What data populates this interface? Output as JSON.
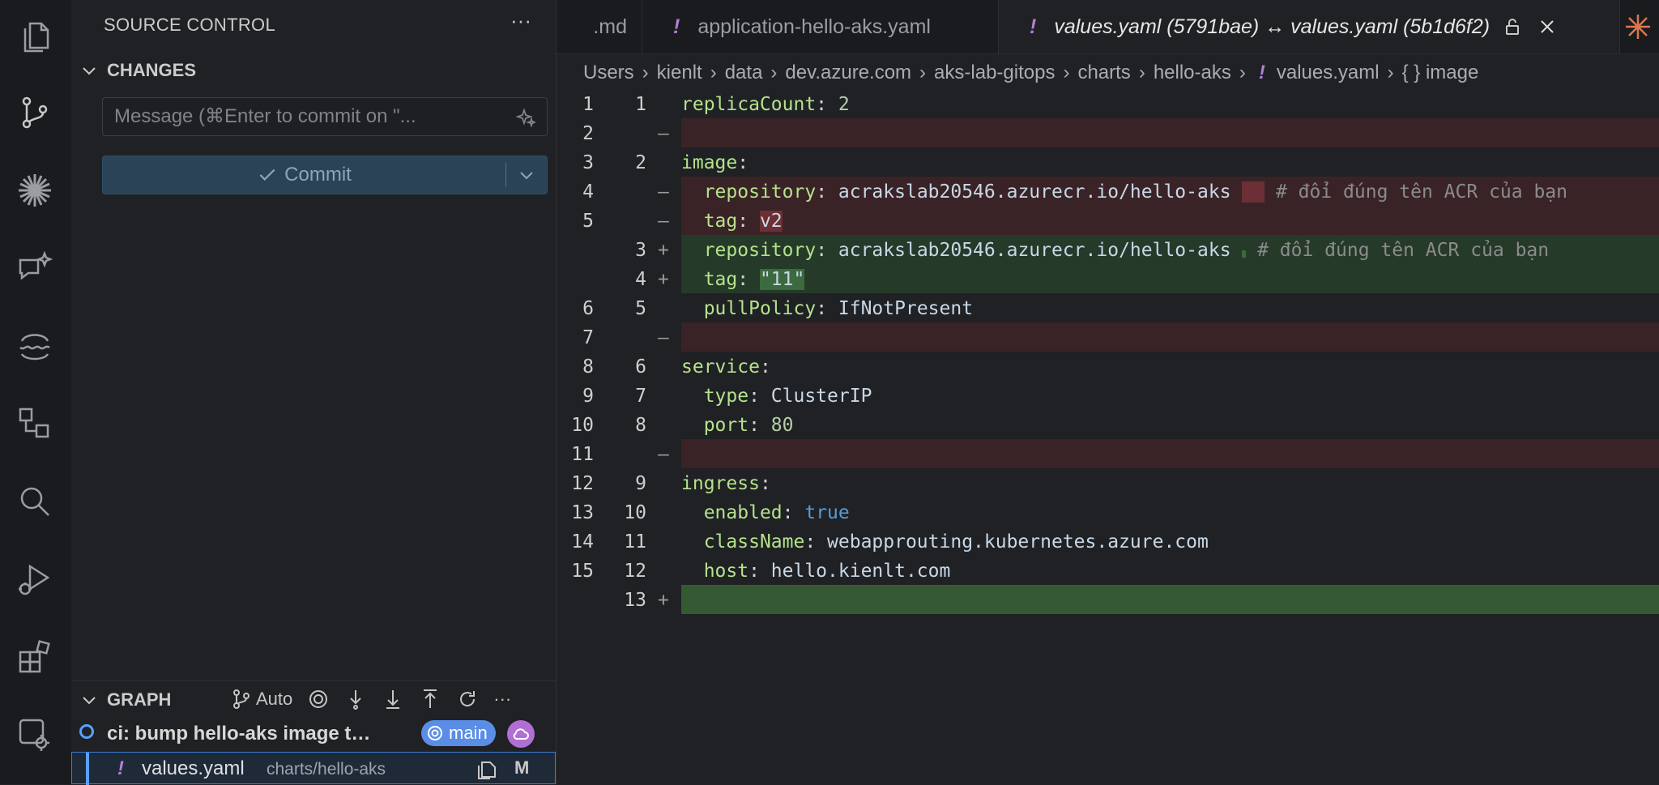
{
  "activity_bar": {
    "icons": [
      "explorer-icon",
      "source-control-icon",
      "asterisk-icon",
      "chat-icon",
      "wave-icon",
      "remote-icon",
      "search-icon",
      "run-debug-icon",
      "extensions-icon",
      "settings-gear-icon"
    ]
  },
  "sidebar": {
    "title": "SOURCE CONTROL",
    "more": "···",
    "changes_header": "CHANGES",
    "message_placeholder": "Message (⌘Enter to commit on \"...",
    "commit_label": "Commit",
    "graph": {
      "title": "GRAPH",
      "auto_label": "Auto",
      "commit_message": "ci: bump hello-aks image to ...",
      "branch": "main",
      "file_name": "values.yaml",
      "file_path": "charts/hello-aks",
      "file_status": "M"
    }
  },
  "editor": {
    "tabs": [
      {
        "label": ".md",
        "bang": false
      },
      {
        "label": "application-hello-aks.yaml",
        "bang": true
      },
      {
        "label": "values.yaml (5791bae) ↔ values.yaml (5b1d6f2)",
        "bang": true
      }
    ],
    "breadcrumb": [
      "Users",
      "kienlt",
      "data",
      "dev.azure.com",
      "aks-lab-gitops",
      "charts",
      "hello-aks",
      "values.yaml",
      "{ } image"
    ],
    "lines": [
      {
        "ln1": "1",
        "ln2": "1",
        "mark": "",
        "type": "ctx",
        "key": "replicaCount",
        "val": "2",
        "valType": "n"
      },
      {
        "ln1": "2",
        "ln2": "",
        "mark": "—",
        "type": "del",
        "key": "",
        "val": ""
      },
      {
        "ln1": "3",
        "ln2": "2",
        "mark": "",
        "type": "ctx",
        "key": "image",
        "val": "",
        "valType": ""
      },
      {
        "ln1": "4",
        "ln2": "",
        "mark": "—",
        "type": "del",
        "key": "  repository",
        "val": "acrakslab20546.azurecr.io/hello-aks",
        "gap": "  ",
        "comment": "# đổi đúng tên ACR của bạn"
      },
      {
        "ln1": "5",
        "ln2": "",
        "mark": "—",
        "type": "del",
        "key": "  tag",
        "val": "v2"
      },
      {
        "ln1": "",
        "ln2": "3",
        "mark": "+",
        "type": "add",
        "key": "  repository",
        "val": "acrakslab20546.azurecr.io/hello-aks",
        "comment": "# đổi đúng tên ACR của bạn"
      },
      {
        "ln1": "",
        "ln2": "4",
        "mark": "+",
        "type": "add",
        "key": "  tag",
        "val": "\"11\""
      },
      {
        "ln1": "6",
        "ln2": "5",
        "mark": "",
        "type": "ctx",
        "key": "  pullPolicy",
        "val": "IfNotPresent",
        "valType": "v"
      },
      {
        "ln1": "7",
        "ln2": "",
        "mark": "—",
        "type": "del",
        "key": "",
        "val": ""
      },
      {
        "ln1": "8",
        "ln2": "6",
        "mark": "",
        "type": "ctx",
        "key": "service",
        "val": "",
        "valType": ""
      },
      {
        "ln1": "9",
        "ln2": "7",
        "mark": "",
        "type": "ctx",
        "key": "  type",
        "val": "ClusterIP",
        "valType": "v"
      },
      {
        "ln1": "10",
        "ln2": "8",
        "mark": "",
        "type": "ctx",
        "key": "  port",
        "val": "80",
        "valType": "n"
      },
      {
        "ln1": "11",
        "ln2": "",
        "mark": "—",
        "type": "del",
        "key": "",
        "val": ""
      },
      {
        "ln1": "12",
        "ln2": "9",
        "mark": "",
        "type": "ctx",
        "key": "ingress",
        "val": "",
        "valType": ""
      },
      {
        "ln1": "13",
        "ln2": "10",
        "mark": "",
        "type": "ctx",
        "key": "  enabled",
        "val": "true",
        "valType": "b"
      },
      {
        "ln1": "14",
        "ln2": "11",
        "mark": "",
        "type": "ctx",
        "key": "  className",
        "val": "webapprouting.kubernetes.azure.com",
        "valType": "v"
      },
      {
        "ln1": "15",
        "ln2": "12",
        "mark": "",
        "type": "ctx",
        "key": "  host",
        "val": "hello.kienlt.com",
        "valType": "v"
      },
      {
        "ln1": "",
        "ln2": "13",
        "mark": "+",
        "type": "addfull",
        "key": "",
        "val": ""
      }
    ]
  },
  "colors": {
    "accent": "#3a7bd5",
    "deleted_line": "#3a2326",
    "added_line": "#253a29"
  }
}
